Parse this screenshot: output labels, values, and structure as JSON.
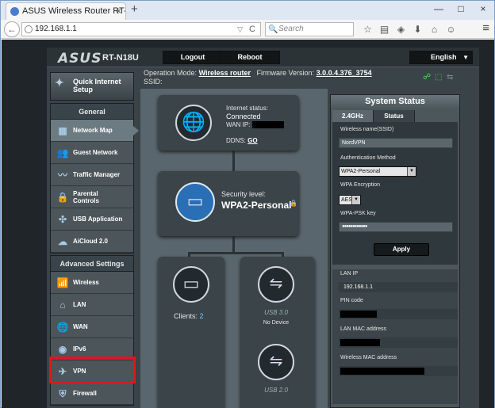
{
  "browser": {
    "tab_title": "ASUS Wireless Router RT-N...",
    "tab_close": "×",
    "new_tab": "+",
    "window_controls": [
      "—",
      "□",
      "×"
    ],
    "url": "192.168.1.1",
    "search_placeholder": "Search",
    "toolbar_icons": [
      "star-icon",
      "reader-icon",
      "pocket-icon",
      "download-icon",
      "home-icon",
      "chat-icon"
    ],
    "glyphs": {
      "back": "←",
      "url_dropdown": "▽",
      "reload": "C",
      "search": "🔍",
      "menu": "≡",
      "toolbar": [
        "☆",
        "▤",
        "◈",
        "⬇",
        "⌂",
        "☺"
      ]
    }
  },
  "router": {
    "logo": "ASUS",
    "model": "RT-N18U",
    "logout": "Logout",
    "reboot": "Reboot",
    "language": "English",
    "op_mode_label": "Operation Mode:",
    "op_mode_value": "Wireless router",
    "firmware_label": "Firmware Version:",
    "firmware_value": "3.0.0.4.376_3754",
    "ssid_label": "SSID:",
    "status_icons": [
      "network-icon",
      "usb-status-icon",
      "usb-icon"
    ],
    "glyphs": {
      "lang_arrow": "▼",
      "status": [
        "☍",
        "⬚",
        "⇆"
      ],
      "qis": "✦",
      "globe": "🌐",
      "router": "▭",
      "lock": "🔒",
      "monitor": "▭",
      "usb": "⇋",
      "dropdown": "▼"
    }
  },
  "sidebar": {
    "quick_setup": "Quick Internet Setup",
    "general_header": "General",
    "general_items": [
      {
        "label": "Network Map",
        "icon": "▦"
      },
      {
        "label": "Guest Network",
        "icon": "👥"
      },
      {
        "label": "Traffic Manager",
        "icon": "〰"
      },
      {
        "label": "Parental Controls",
        "icon": "🔒"
      },
      {
        "label": "USB Application",
        "icon": "✣"
      },
      {
        "label": "AiCloud 2.0",
        "icon": "☁"
      }
    ],
    "advanced_header": "Advanced Settings",
    "advanced_items": [
      {
        "label": "Wireless",
        "icon": "📶"
      },
      {
        "label": "LAN",
        "icon": "⌂"
      },
      {
        "label": "WAN",
        "icon": "🌐"
      },
      {
        "label": "IPv6",
        "icon": "◉"
      },
      {
        "label": "VPN",
        "icon": "✈"
      },
      {
        "label": "Firewall",
        "icon": "⛨"
      }
    ]
  },
  "map": {
    "internet_status_label": "Internet status:",
    "internet_status_value": "Connected",
    "wan_ip_label": "WAN IP:",
    "ddns_label": "DDNS:",
    "ddns_link": "GO",
    "security_label": "Security level:",
    "security_value": "WPA2-Personal",
    "clients_label": "Clients:",
    "clients_count": "2",
    "usb1_label": "USB 3.0",
    "usb1_status": "No Device",
    "usb2_label": "USB 2.0"
  },
  "status_panel": {
    "title": "System Status",
    "tabs": [
      "2.4GHz",
      "Status"
    ],
    "wireless_name_label": "Wireless name(SSID)",
    "wireless_name_value": "NordVPN",
    "auth_method_label": "Authentication Method",
    "auth_method_value": "WPA2-Personal",
    "encryption_label": "WPA Encryption",
    "encryption_value": "AES",
    "psk_label": "WPA-PSK key",
    "psk_value": "●●●●●●●●●●●●",
    "apply": "Apply",
    "lan_ip_label": "LAN IP",
    "lan_ip_value": "192.168.1.1",
    "pin_code_label": "PIN code",
    "lan_mac_label": "LAN MAC address",
    "wireless_mac_label": "Wireless MAC address"
  }
}
